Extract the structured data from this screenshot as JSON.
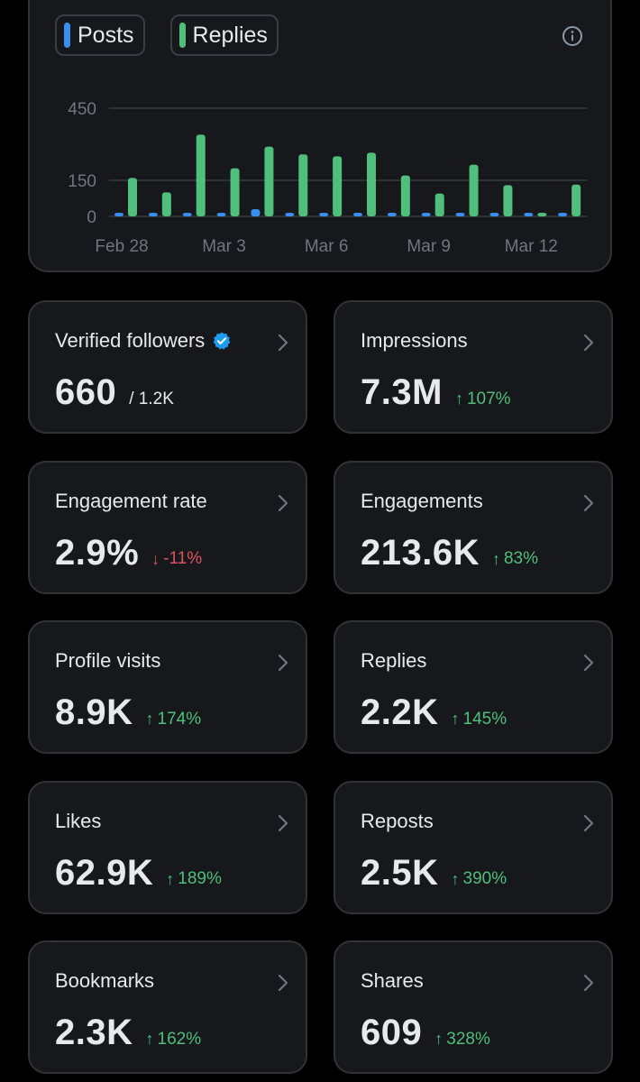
{
  "chart": {
    "legend": [
      {
        "label": "Posts",
        "color": "#3a8ef0"
      },
      {
        "label": "Replies",
        "color": "#4fbf7b"
      }
    ],
    "info_icon": "info-icon"
  },
  "chart_data": {
    "type": "bar",
    "x_tick_labels": [
      "Feb 28",
      "Mar 3",
      "Mar 6",
      "Mar 9",
      "Mar 12"
    ],
    "y_tick_labels": [
      "450",
      "150",
      "0"
    ],
    "ylim": [
      0,
      450
    ],
    "grid": true,
    "legend_position": "top-left",
    "series": [
      {
        "name": "Posts",
        "color": "#3a8ef0",
        "values": [
          6,
          6,
          10,
          10,
          30,
          12,
          12,
          12,
          10,
          10,
          8,
          6,
          6,
          6
        ]
      },
      {
        "name": "Replies",
        "color": "#4fbf7b",
        "values": [
          160,
          100,
          340,
          200,
          290,
          258,
          250,
          265,
          170,
          95,
          215,
          130,
          12,
          132
        ]
      }
    ]
  },
  "cards": [
    {
      "title": "Verified followers",
      "value": "660",
      "sub": "/ 1.2K",
      "verified": true
    },
    {
      "title": "Impressions",
      "value": "7.3M",
      "change": "107%",
      "direction": "up"
    },
    {
      "title": "Engagement rate",
      "value": "2.9%",
      "change": "-11%",
      "direction": "down"
    },
    {
      "title": "Engagements",
      "value": "213.6K",
      "change": "83%",
      "direction": "up"
    },
    {
      "title": "Profile visits",
      "value": "8.9K",
      "change": "174%",
      "direction": "up"
    },
    {
      "title": "Replies",
      "value": "2.2K",
      "change": "145%",
      "direction": "up"
    },
    {
      "title": "Likes",
      "value": "62.9K",
      "change": "189%",
      "direction": "up"
    },
    {
      "title": "Reposts",
      "value": "2.5K",
      "change": "390%",
      "direction": "up"
    },
    {
      "title": "Bookmarks",
      "value": "2.3K",
      "change": "162%",
      "direction": "up"
    },
    {
      "title": "Shares",
      "value": "609",
      "change": "328%",
      "direction": "up"
    }
  ]
}
